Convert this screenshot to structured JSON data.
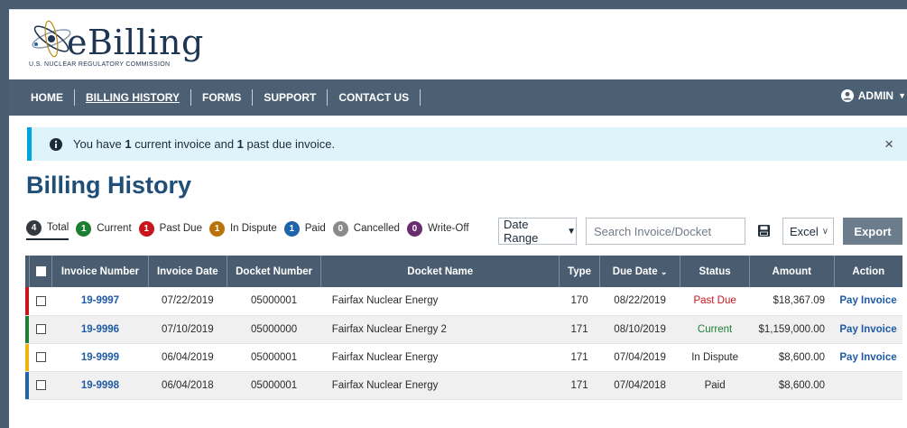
{
  "logo": {
    "wordmark": "eBilling",
    "subtitle": "U.S. NUCLEAR REGULATORY COMMISSION"
  },
  "nav": {
    "items": [
      "HOME",
      "BILLING HISTORY",
      "FORMS",
      "SUPPORT",
      "CONTACT US"
    ],
    "active": "BILLING HISTORY",
    "user": "ADMIN"
  },
  "alert": {
    "part1": "You have ",
    "current_count": "1",
    "part2": " current invoice and ",
    "past_due_count": "1",
    "part3": " past due invoice.",
    "close": "×"
  },
  "page_title": "Billing History",
  "filters": [
    {
      "count": "4",
      "label": "Total",
      "color": "#343a40"
    },
    {
      "count": "1",
      "label": "Current",
      "color": "#1e7e34"
    },
    {
      "count": "1",
      "label": "Past Due",
      "color": "#c9161e"
    },
    {
      "count": "1",
      "label": "In Dispute",
      "color": "#b8730a"
    },
    {
      "count": "1",
      "label": "Paid",
      "color": "#1f64a8"
    },
    {
      "count": "0",
      "label": "Cancelled",
      "color": "#8a8a8a"
    },
    {
      "count": "0",
      "label": "Write-Off",
      "color": "#6a2d6e"
    }
  ],
  "toolbar": {
    "date_range": "Date Range",
    "search_placeholder": "Search Invoice/Docket",
    "format": "Excel",
    "export": "Export"
  },
  "table": {
    "headers": [
      "Invoice Number",
      "Invoice Date",
      "Docket Number",
      "Docket Name",
      "Type",
      "Due Date",
      "Status",
      "Amount",
      "Action"
    ],
    "rows": [
      {
        "stripe": "#c9161e",
        "invoice": "19-9997",
        "invoice_date": "07/22/2019",
        "docket_number": "05000001",
        "docket_name": "Fairfax Nuclear Energy",
        "type": "170",
        "due_date": "08/22/2019",
        "status": "Past Due",
        "status_color": "#c9161e",
        "amount": "$18,367.09",
        "action": "Pay Invoice"
      },
      {
        "stripe": "#1e7e34",
        "invoice": "19-9996",
        "invoice_date": "07/10/2019",
        "docket_number": "05000000",
        "docket_name": "Fairfax Nuclear Energy 2",
        "type": "171",
        "due_date": "08/10/2019",
        "status": "Current",
        "status_color": "#1e7e34",
        "amount": "$1,159,000.00",
        "action": "Pay Invoice"
      },
      {
        "stripe": "#f2b30c",
        "invoice": "19-9999",
        "invoice_date": "06/04/2019",
        "docket_number": "05000001",
        "docket_name": "Fairfax Nuclear Energy",
        "type": "171",
        "due_date": "07/04/2019",
        "status": "In Dispute",
        "status_color": "#2a2a2a",
        "amount": "$8,600.00",
        "action": "Pay Invoice"
      },
      {
        "stripe": "#1f64a8",
        "invoice": "19-9998",
        "invoice_date": "06/04/2018",
        "docket_number": "05000001",
        "docket_name": "Fairfax Nuclear Energy",
        "type": "171",
        "due_date": "07/04/2018",
        "status": "Paid",
        "status_color": "#2a2a2a",
        "amount": "$8,600.00",
        "action": ""
      }
    ]
  }
}
